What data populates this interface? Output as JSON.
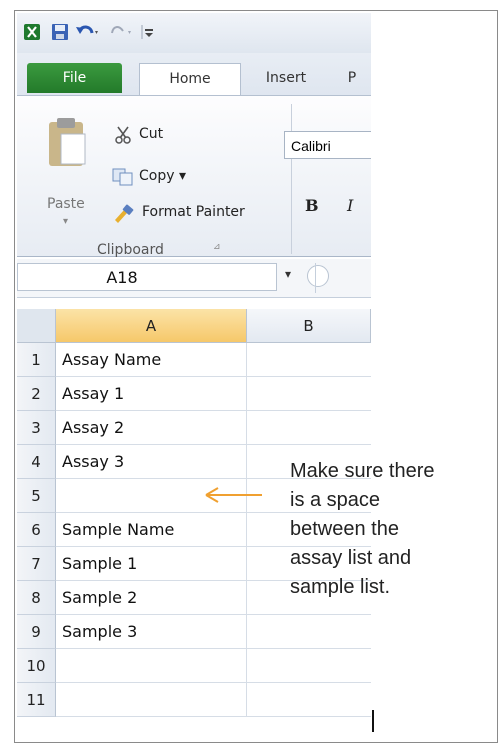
{
  "qat": {
    "excel_icon": "excel-icon",
    "save_icon": "save-icon",
    "undo_icon": "undo-icon",
    "redo_icon": "redo-icon",
    "customize_icon": "customize-icon"
  },
  "tabs": [
    {
      "label": "File"
    },
    {
      "label": "Home"
    },
    {
      "label": "Insert"
    },
    {
      "label": "P"
    }
  ],
  "ribbon": {
    "paste_label": "Paste",
    "cut_label": "Cut",
    "copy_label": "Copy ▾",
    "format_painter_label": "Format Painter",
    "group_label": "Clipboard",
    "font_name": "Calibri",
    "bold": "B",
    "italic": "I"
  },
  "name_box": {
    "value": "A18"
  },
  "columns": [
    {
      "label": "A",
      "selected": true
    },
    {
      "label": "B",
      "selected": false
    }
  ],
  "rows": [
    {
      "num": "1",
      "a": "Assay Name"
    },
    {
      "num": "2",
      "a": "Assay 1"
    },
    {
      "num": "3",
      "a": "Assay 2"
    },
    {
      "num": "4",
      "a": "Assay 3"
    },
    {
      "num": "5",
      "a": ""
    },
    {
      "num": "6",
      "a": "Sample Name"
    },
    {
      "num": "7",
      "a": "Sample 1"
    },
    {
      "num": "8",
      "a": "Sample 2"
    },
    {
      "num": "9",
      "a": "Sample 3"
    },
    {
      "num": "10",
      "a": ""
    },
    {
      "num": "11",
      "a": ""
    }
  ],
  "annotation": {
    "lines": [
      "Make sure there",
      "is a space",
      "between the",
      "assay list and",
      "sample list."
    ],
    "arrow_color": "#f0a030"
  },
  "colors": {
    "file_tab": "#2e8b34",
    "selected_header": "#f6c86a"
  }
}
